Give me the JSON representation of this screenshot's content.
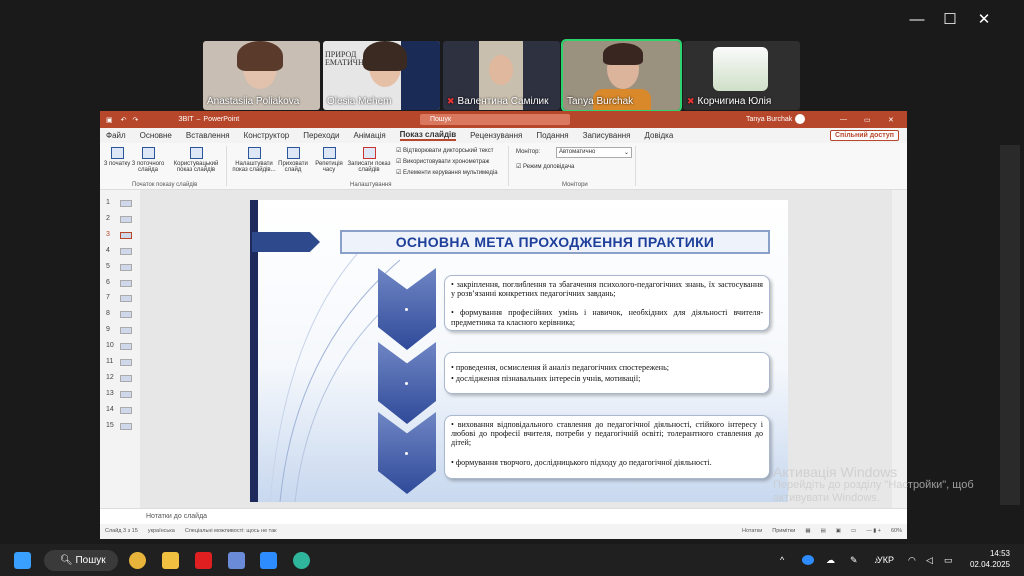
{
  "zoom": {
    "controls": [
      "—",
      "☐",
      "✕"
    ],
    "participants": [
      {
        "name": "Anastasiia Poliakova",
        "muted": false,
        "bg": "#bfb2a6"
      },
      {
        "name": "Olesia Mehem",
        "muted": false,
        "bg": "#d7d7d7"
      },
      {
        "name": "Валентина Самілик",
        "muted": true,
        "bg": "#2b2f3a"
      },
      {
        "name": "Tanya Burchak",
        "muted": false,
        "bg": "#9a8f80",
        "active": true
      },
      {
        "name": "Корчигина Юлія",
        "muted": true,
        "bg": "#3a3a3a"
      }
    ]
  },
  "ppt": {
    "title_file": "ЗВІТ",
    "title_app": "PowerPoint",
    "search": "Пошук",
    "user": "Tanya Burchak",
    "share": "Спільний доступ",
    "tabs": [
      "Файл",
      "Основне",
      "Вставлення",
      "Конструктор",
      "Переходи",
      "Анімація",
      "Показ слайдів",
      "Рецензування",
      "Подання",
      "Записування",
      "Довідка"
    ],
    "active_tab": "Показ слайдів",
    "ribbon": {
      "from_start": "З початку",
      "from_current": "З поточного слайда",
      "custom": "Користувацький показ слайдів",
      "group_start": "Початок показу слайдів",
      "setup": "Налаштувати показ слайдів...",
      "hide": "Приховати слайд",
      "rehearse": "Репетиція часу",
      "record": "Записати показ слайдів",
      "chk1": "Відтворювати дикторський текст",
      "chk2": "Використовувати хронометраж",
      "chk3": "Елементи керування мультимедіа",
      "group_setup": "Налаштування",
      "monitor_label": "Монітор:",
      "monitor_value": "Автоматично",
      "presenter": "Режим доповідача",
      "group_monitors": "Монітори"
    },
    "slide_count": 15,
    "current_slide": 3,
    "slide": {
      "title": "ОСНОВНА МЕТА ПРОХОДЖЕННЯ ПРАКТИКИ",
      "box1": [
        "закріплення, поглиблення та збагачення психолого-педагогічних знань, їх застосування у розв’язанні конкретних педагогічних завдань;",
        "формування професійних умінь і навичок, необхідних для діяльності вчителя-предметника та класного керівника;"
      ],
      "box2": [
        "проведення, осмислення й аналіз педагогічних спостережень;",
        "дослідження пізнавальних інтересів учнів, мотивації;"
      ],
      "box3": [
        "виховання відповідального ставлення до педагогічної діяльності, стійкого інтересу і любові до професії вчителя, потреби у педагогічній освіті; толерантного ставлення до дітей;",
        "формування творчого, дослідницького підходу до педагогічної діяльності."
      ]
    },
    "notes": "Нотатки до слайда",
    "status": {
      "slide": "Слайд 3 з 15",
      "lang": "українська",
      "access": "Спеціальні можливості: щось не так",
      "notes_btn": "Нотатки",
      "comments": "Примітки",
      "zoom": "60%"
    }
  },
  "activation": {
    "title": "Активація Windows",
    "line1": "Перейдіть до розділу \"Настройки\", щоб",
    "line2": "активувати Windows."
  },
  "taskbar": {
    "search": "Пошук",
    "lang": "УКР",
    "time": "14:53",
    "date": "02.04.2025"
  }
}
